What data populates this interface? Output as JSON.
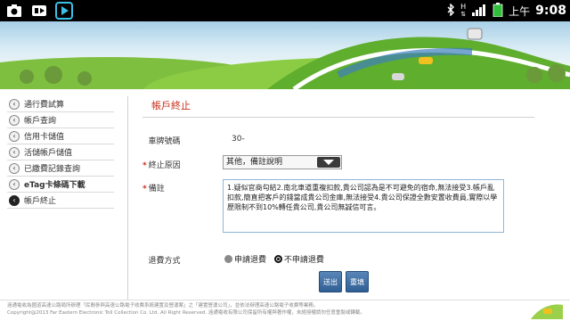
{
  "status_bar": {
    "time": "9:08",
    "ampm": "上午",
    "signal_label": "H"
  },
  "nav": {
    "items": [
      {
        "label": "通行費試算",
        "active": false
      },
      {
        "label": "帳戶查詢",
        "active": false
      },
      {
        "label": "信用卡儲值",
        "active": false
      },
      {
        "label": "活儲帳戶儲值",
        "active": false
      },
      {
        "label": "已繳費記錄查詢",
        "active": false
      },
      {
        "label": "eTag卡條碼下載",
        "active": false
      },
      {
        "label": "帳戶終止",
        "active": true
      }
    ]
  },
  "main": {
    "title": "帳戶終止",
    "plate": {
      "label": "車牌號碼",
      "value": "30-"
    },
    "reason": {
      "label": "終止原因",
      "selected": "其他，備註說明"
    },
    "note": {
      "label": "備註",
      "value": "1.疑似官商勾結2.南北車道重複扣款,貴公司認為是不可避免的宿命,無法接受3.帳戶亂扣款,簡直把客戶的錢當成貴公司金庫,無法接受4.貴公司保證全數安置收費員,實際以學歷限制不到10%轉任貴公司,貴公司無誠信可言。"
    },
    "refund": {
      "label": "退費方式",
      "options": [
        {
          "label": "申請退費",
          "selected": false
        },
        {
          "label": "不申請退費",
          "selected": true
        }
      ]
    },
    "submit_label": "送出",
    "reset_label": "重填"
  },
  "footer": {
    "line1": "遠通電收為國道高速公路局所辦理「民間參與高速公路電子收費系統建置及營運案」之「建置營運公司」，並依法辦理高速公路電子收費等業務。",
    "line2": "Copyright@2013 Far Eastern Electronic Toll Collection Co. Ltd. All Right Reserved. 遠通電收有限公司保留所有權與著作權，未經授權請勿任意重製或轉載。"
  },
  "colors": {
    "accent_red": "#c8321e",
    "button_blue": "#2f5f95",
    "status_bar": "#000000"
  }
}
